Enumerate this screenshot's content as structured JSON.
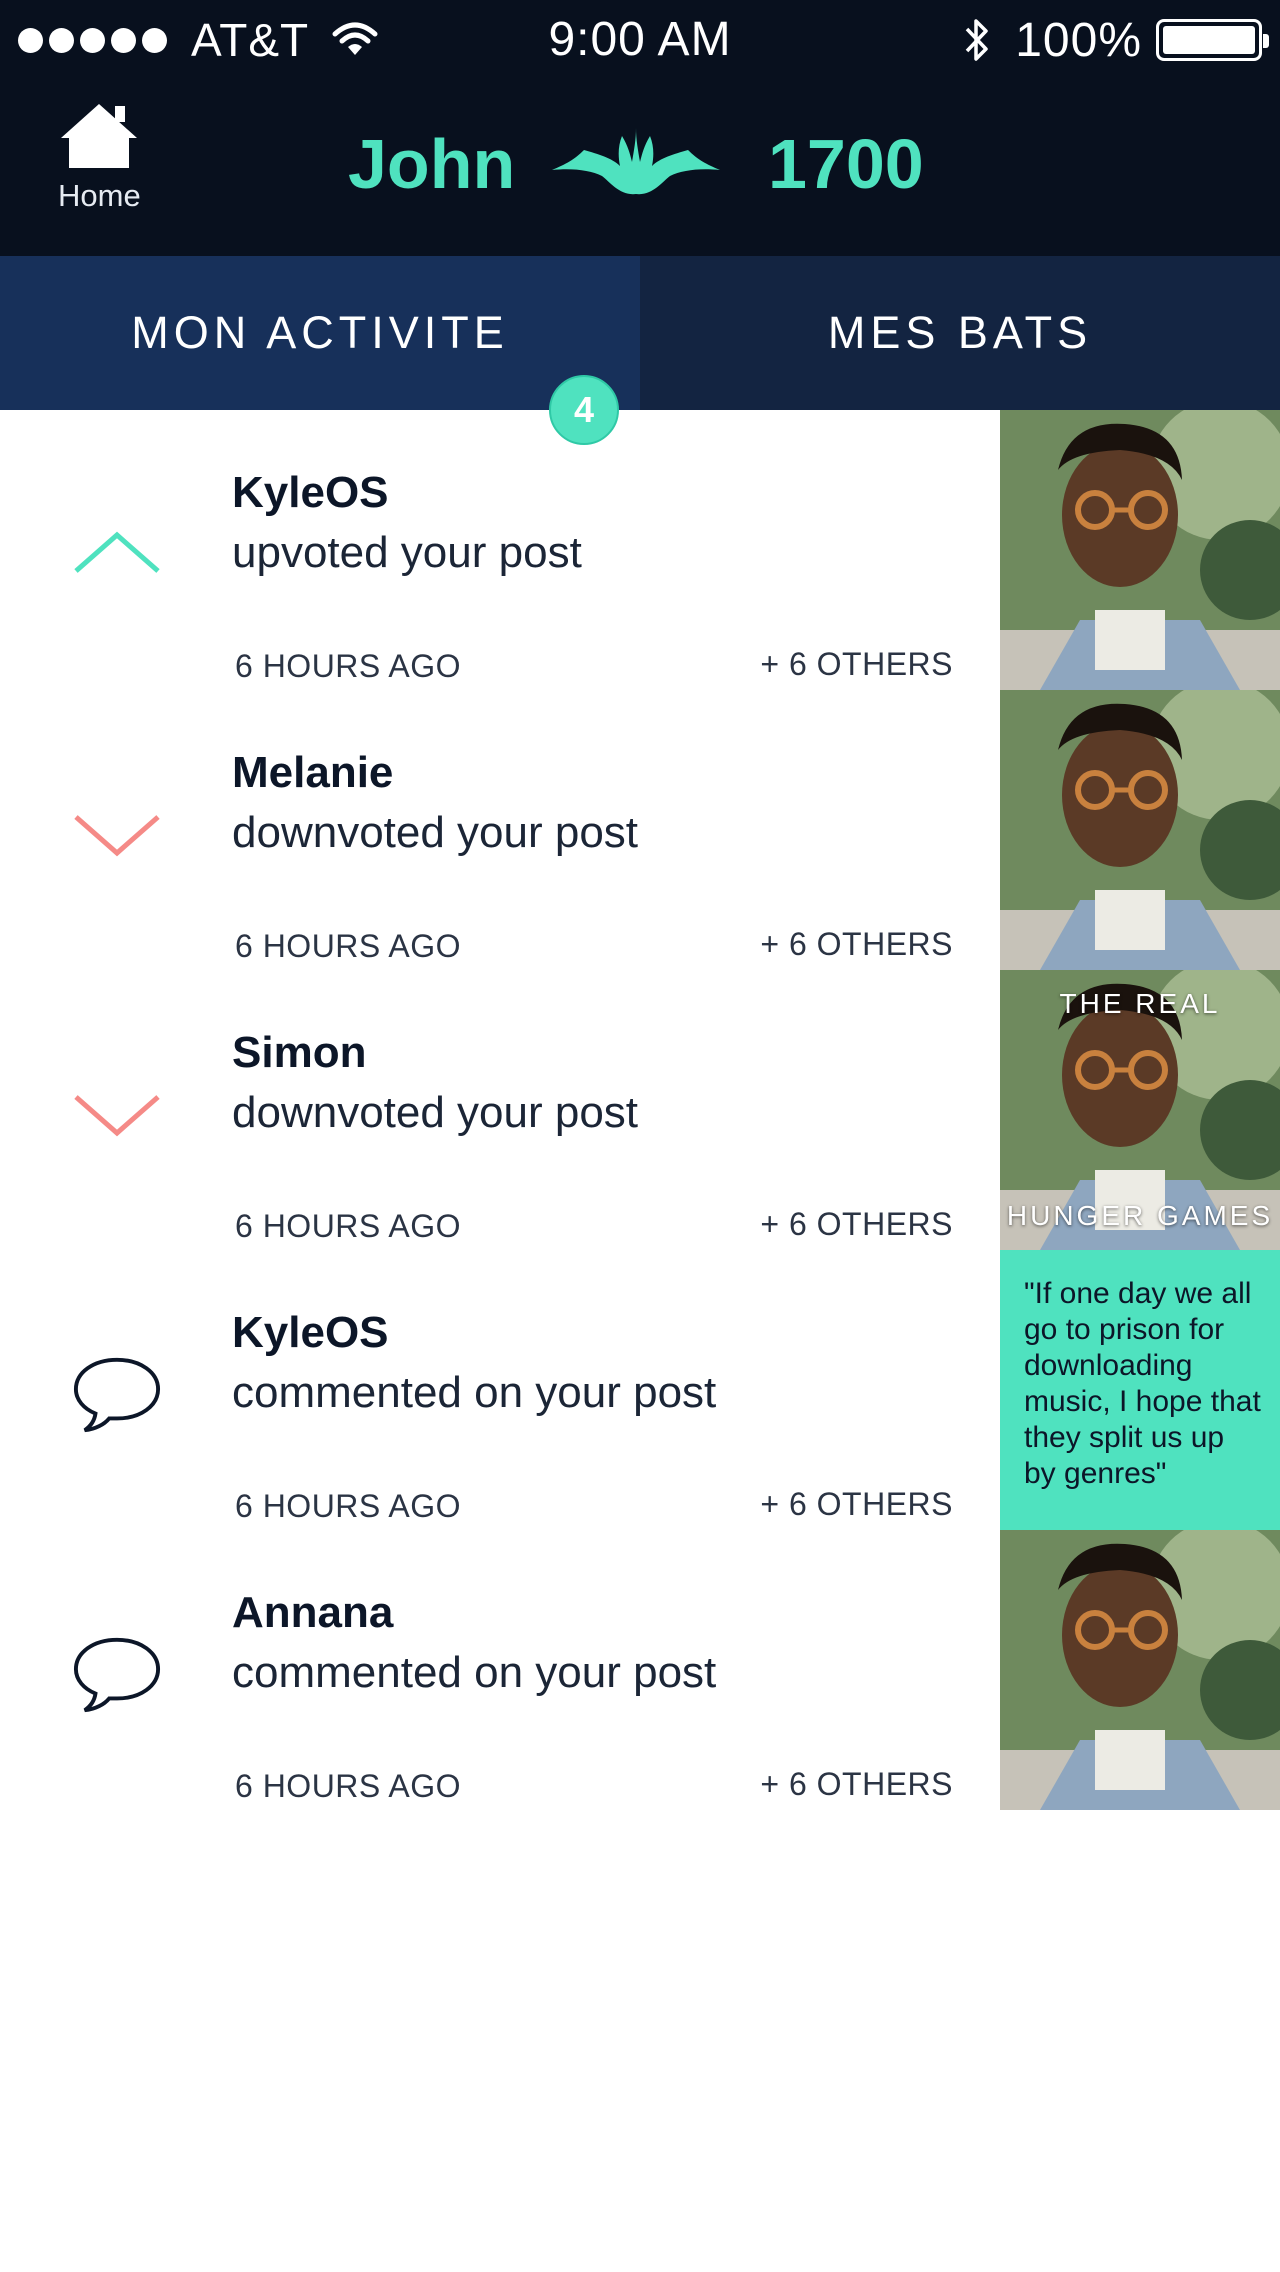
{
  "status_bar": {
    "carrier": "AT&T",
    "time": "9:00 AM",
    "battery": "100%",
    "battery_level": 1.0
  },
  "header": {
    "home_label": "Home",
    "user_name": "John",
    "score": "1700"
  },
  "tabs": [
    {
      "label": "MON ACTIVITE",
      "active": true
    },
    {
      "label": "MES BATS",
      "active": false
    }
  ],
  "badge": "4",
  "colors": {
    "accent": "#4fe2bf",
    "downvote": "#f58a87",
    "header_bg": "#08101e",
    "tab_active": "#17305a",
    "tab_inactive": "#132441"
  },
  "feed": [
    {
      "icon": "upvote-icon",
      "user": "KyleOS",
      "action": "upvoted your post",
      "time": "6 HOURS AGO",
      "others": "+ 6 OTHERS",
      "thumb": "photo"
    },
    {
      "icon": "downvote-icon",
      "user": "Melanie",
      "action": "downvoted your post",
      "time": "6 HOURS AGO",
      "others": "+ 6 OTHERS",
      "thumb": "photo"
    },
    {
      "icon": "downvote-icon",
      "user": "Simon",
      "action": "downvoted your post",
      "time": "6 HOURS AGO",
      "others": "+ 6 OTHERS",
      "thumb": "photo-caption",
      "caption_top": "THE REAL",
      "caption_bottom": "HUNGER GAMES"
    },
    {
      "icon": "comment-icon",
      "user": "KyleOS",
      "action": "commented on your post",
      "time": "6 HOURS AGO",
      "others": "+ 6 OTHERS",
      "thumb": "quote",
      "quote": "\"If one day we all go to prison for downloading music, I hope that they split us up by genres\""
    },
    {
      "icon": "comment-icon",
      "user": "Annana",
      "action": "commented on your post",
      "time": "6 HOURS AGO",
      "others": "+ 6 OTHERS",
      "thumb": "photo"
    }
  ]
}
